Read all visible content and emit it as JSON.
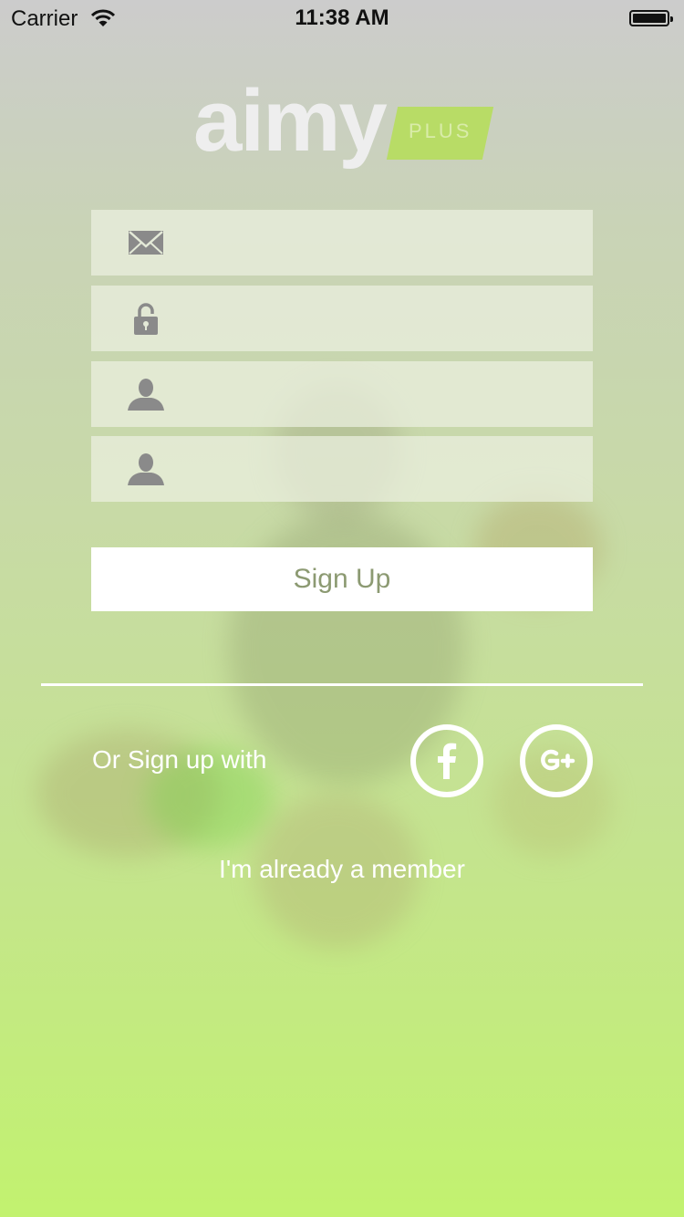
{
  "status_bar": {
    "carrier": "Carrier",
    "time": "11:38 AM"
  },
  "logo": {
    "name": "aimy",
    "badge": "PLUS"
  },
  "form": {
    "fields": [
      {
        "icon": "envelope-icon",
        "value": ""
      },
      {
        "icon": "lock-icon",
        "value": ""
      },
      {
        "icon": "user-icon",
        "value": ""
      },
      {
        "icon": "user-icon",
        "value": ""
      }
    ],
    "signup_label": "Sign Up"
  },
  "social": {
    "label": "Or Sign up with",
    "facebook_icon": "facebook-icon",
    "google_icon": "google-plus-icon"
  },
  "member_link": "I'm already a member",
  "colors": {
    "accent": "#b8dc66",
    "button_text": "#8c9a72"
  }
}
